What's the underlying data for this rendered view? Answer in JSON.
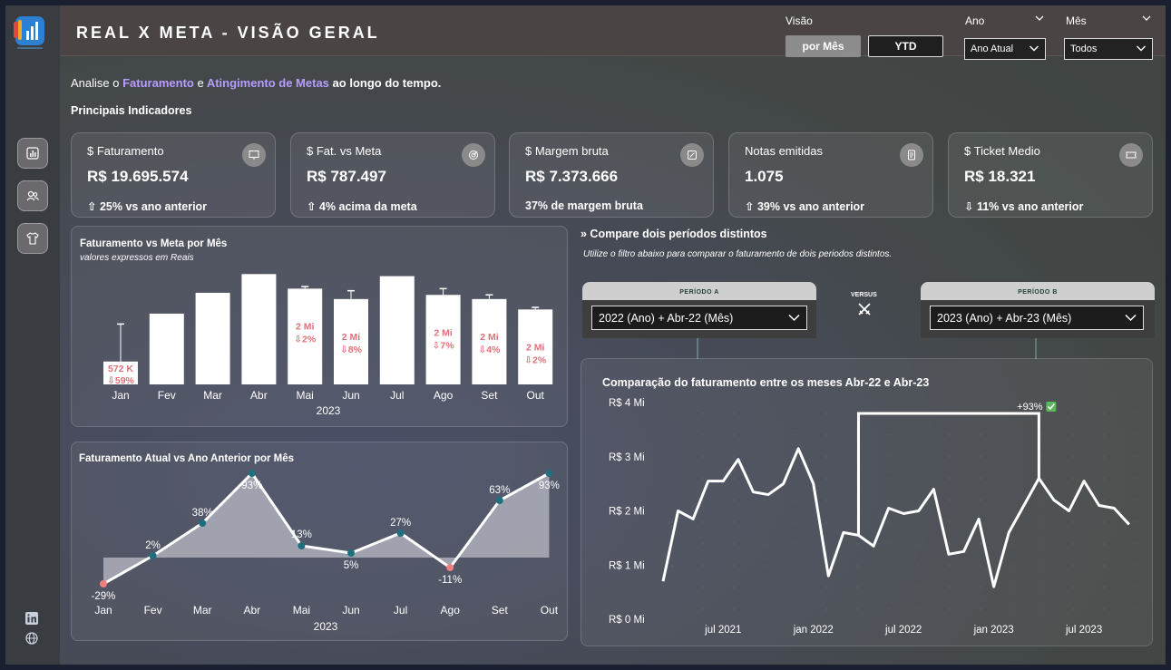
{
  "header": {
    "title": "REAL X META - VISÃO GERAL",
    "visao_label": "Visão",
    "visao_options": [
      "por Mês",
      "YTD"
    ],
    "ano_label": "Ano",
    "ano_value": "Ano Atual",
    "mes_label": "Mês",
    "mes_value": "Todos"
  },
  "intro": {
    "prefix": "Analise o",
    "highlight1": "Faturamento",
    "mid": "e",
    "highlight2": "Atingimento de Metas",
    "suffix": "ao longo do tempo.",
    "section_plain": "Principais",
    "section_bold": "Indicadores"
  },
  "colors": {
    "accent_purple": "#b89cff",
    "bar_white": "#ffffff",
    "label_red": "#e0707a",
    "dot_teal": "#1f6f7e",
    "dot_red": "#f08080",
    "check_green": "#5cb85c"
  },
  "kpis": [
    {
      "caption": "$ Faturamento",
      "value": "R$ 19.695.574",
      "sub": "⇧ 25% vs ano anterior",
      "icon": "presentation-icon"
    },
    {
      "caption": "$ Fat. vs Meta",
      "value": "R$ 787.497",
      "sub": "⇧ 4% acima da meta",
      "icon": "target-icon"
    },
    {
      "caption": "$ Margem bruta",
      "value": "R$ 7.373.666",
      "sub": "37% de margem bruta",
      "icon": "margin-icon"
    },
    {
      "caption": "Notas emitidas",
      "value": "1.075",
      "sub": "⇧ 39% vs ano anterior",
      "icon": "document-icon"
    },
    {
      "caption": "$ Ticket Medio",
      "value": "R$ 18.321",
      "sub": "⇩ 11% vs ano anterior",
      "icon": "ticket-icon"
    }
  ],
  "bar_panel": {
    "title": "Faturamento vs Meta por Mês",
    "subtitle": "valores expressos em Reais"
  },
  "line_panel": {
    "title": "Faturamento Atual vs Ano Anterior por Mês"
  },
  "compare": {
    "title": "» Compare dois períodos distintos",
    "subtitle": "Utilize o filtro abaixo para comparar o faturamento de dois periodos distintos.",
    "period_a_label": "PERÍODO A",
    "period_a_value": "2022 (Ano) + Abr-22 (Mês)",
    "versus": "VERSUS",
    "period_b_label": "PERÍODO B",
    "period_b_value": "2023 (Ano) + Abr-23 (Mês)",
    "chart_title": "Comparação do faturamento entre os meses Abr-22 e Abr-23"
  },
  "chart_data": [
    {
      "type": "bar",
      "title": "Faturamento vs Meta por Mês",
      "subtitle": "valores expressos em Reais",
      "xlabel": "2023",
      "categories": [
        "Jan",
        "Fev",
        "Mar",
        "Abr",
        "Mai",
        "Jun",
        "Jul",
        "Ago",
        "Set",
        "Out"
      ],
      "values": [
        0.55,
        1.7,
        2.2,
        2.65,
        2.3,
        2.05,
        2.6,
        2.15,
        2.05,
        1.8
      ],
      "meta": [
        1.45,
        1.7,
        2.2,
        2.65,
        2.35,
        2.25,
        2.6,
        2.3,
        2.15,
        1.85
      ],
      "labels": [
        "572 K",
        "",
        "",
        "",
        "2 Mi",
        "2 Mi",
        "",
        "2 Mi",
        "2 Mi",
        "2 Mi"
      ],
      "deltas": [
        "⇩59%",
        "",
        "",
        "",
        "⇩2%",
        "⇩8%",
        "",
        "⇩7%",
        "⇩4%",
        "⇩2%"
      ],
      "ylim": [
        0,
        2.7
      ]
    },
    {
      "type": "area",
      "title": "Faturamento Atual vs Ano Anterior por Mês",
      "xlabel": "2023",
      "categories": [
        "Jan",
        "Fev",
        "Mar",
        "Abr",
        "Mai",
        "Jun",
        "Jul",
        "Ago",
        "Set",
        "Out"
      ],
      "values": [
        -29,
        2,
        38,
        93,
        13,
        5,
        27,
        -11,
        63,
        93
      ],
      "labels": [
        "-29%",
        "2%",
        "38%",
        "93%",
        "13%",
        "5%",
        "27%",
        "-11%",
        "63%",
        "93%"
      ],
      "ylim": [
        -35,
        100
      ]
    },
    {
      "type": "line",
      "title": "Comparação do faturamento entre os meses Abr-22 e Abr-23",
      "y_ticks": [
        "R$ 0 Mi",
        "R$ 1 Mi",
        "R$ 2 Mi",
        "R$ 3 Mi",
        "R$ 4 Mi"
      ],
      "x_ticks": [
        "jul 2021",
        "jan 2022",
        "jul 2022",
        "jan 2023",
        "jul 2023"
      ],
      "ylim": [
        0,
        4
      ],
      "x": [
        "2021-03",
        "2021-04",
        "2021-05",
        "2021-06",
        "2021-07",
        "2021-08",
        "2021-09",
        "2021-10",
        "2021-11",
        "2021-12",
        "2022-01",
        "2022-02",
        "2022-03",
        "2022-04",
        "2022-05",
        "2022-06",
        "2022-07",
        "2022-08",
        "2022-09",
        "2022-10",
        "2022-11",
        "2022-12",
        "2023-01",
        "2023-02",
        "2023-03",
        "2023-04",
        "2023-05",
        "2023-06",
        "2023-07",
        "2023-08",
        "2023-09",
        "2023-10"
      ],
      "values": [
        0.7,
        2.0,
        1.85,
        2.55,
        2.55,
        2.95,
        2.35,
        2.3,
        2.5,
        3.15,
        2.5,
        0.8,
        1.6,
        1.55,
        1.35,
        2.05,
        1.95,
        2.0,
        2.4,
        1.2,
        1.25,
        1.85,
        0.6,
        1.6,
        2.1,
        2.6,
        2.2,
        2.0,
        2.55,
        2.1,
        2.05,
        1.75
      ],
      "annotation": "+93%",
      "compare_points": [
        "2022-04",
        "2023-04"
      ]
    }
  ]
}
